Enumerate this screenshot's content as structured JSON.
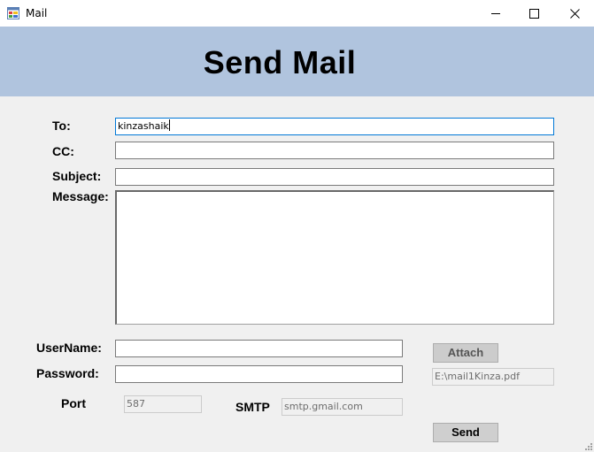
{
  "window": {
    "title": "Mail",
    "controls": {
      "minimize": "minimize-icon",
      "maximize": "maximize-icon",
      "close": "close-icon"
    }
  },
  "header": {
    "title": "Send Mail",
    "band_color": "#b0c4de"
  },
  "form": {
    "to": {
      "label": "To:",
      "value": "kinzashaik"
    },
    "cc": {
      "label": "CC:",
      "value": ""
    },
    "subject": {
      "label": "Subject:",
      "value": ""
    },
    "message": {
      "label": "Message:",
      "value": ""
    },
    "username": {
      "label": "UserName:",
      "value": ""
    },
    "password": {
      "label": "Password:",
      "value": ""
    },
    "port": {
      "label": "Port",
      "value": "587"
    },
    "smtp": {
      "label": "SMTP",
      "value": "smtp.gmail.com"
    },
    "attachment_path": "E:\\mail1Kinza.pdf"
  },
  "buttons": {
    "attach": "Attach",
    "send": "Send"
  }
}
